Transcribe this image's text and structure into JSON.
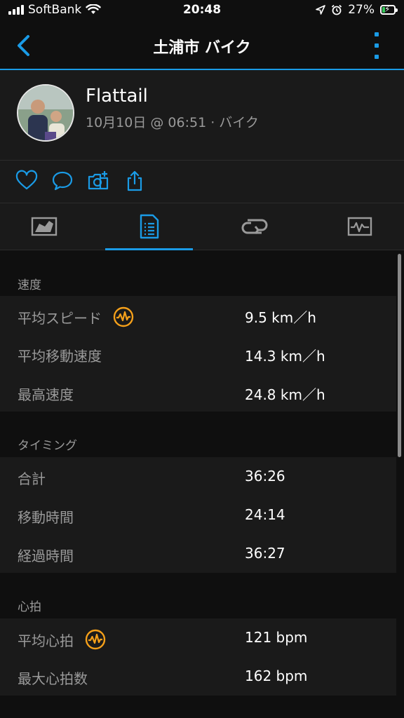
{
  "status": {
    "carrier": "SoftBank",
    "time": "20:48",
    "battery": "27%",
    "battery_level": 0.27
  },
  "nav": {
    "title": "土浦市 バイク"
  },
  "profile": {
    "name": "Flattail",
    "meta": "10月10日 @ 06:51 · バイク"
  },
  "sections": {
    "speed": {
      "header": "速度",
      "rows": [
        {
          "label": "平均スピード",
          "value": "9.5 km／h"
        },
        {
          "label": "平均移動速度",
          "value": "14.3 km／h"
        },
        {
          "label": "最高速度",
          "value": "24.8 km／h"
        }
      ]
    },
    "timing": {
      "header": "タイミング",
      "rows": [
        {
          "label": "合計",
          "value": "36:26"
        },
        {
          "label": "移動時間",
          "value": "24:14"
        },
        {
          "label": "経過時間",
          "value": "36:27"
        }
      ]
    },
    "heart": {
      "header": "心拍",
      "rows": [
        {
          "label": "平均心拍",
          "value": "121 bpm"
        },
        {
          "label": "最大心拍数",
          "value": "162 bpm"
        }
      ]
    }
  },
  "colors": {
    "accent": "#1a9be6",
    "badge": "#f5a01a",
    "battery_fill": "#35c759"
  }
}
